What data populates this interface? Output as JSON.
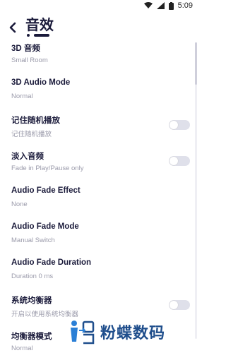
{
  "status_bar": {
    "time": "5:09",
    "icons": [
      "wifi-icon",
      "signal-icon",
      "battery-icon"
    ]
  },
  "header": {
    "title": "音效",
    "back_icon": "chevron-left-icon"
  },
  "settings": {
    "items": [
      {
        "title": "3D 音频",
        "subtitle": "Small Room",
        "toggle": null
      },
      {
        "title": "3D Audio Mode",
        "subtitle": "Normal",
        "toggle": null
      },
      {
        "title": "记住随机播放",
        "subtitle": "记住随机播放",
        "toggle": false
      },
      {
        "title": "淡入音频",
        "subtitle": "Fade in Play/Pause only",
        "toggle": false
      },
      {
        "title": "Audio Fade Effect",
        "subtitle": "None",
        "toggle": null
      },
      {
        "title": "Audio Fade Mode",
        "subtitle": "Manual Switch",
        "toggle": null
      },
      {
        "title": "Audio Fade Duration",
        "subtitle": "Duration 0 ms",
        "toggle": null
      },
      {
        "title": "系统均衡器",
        "subtitle": "开启以使用系统均衡器",
        "toggle": false
      },
      {
        "title": "均衡器模式",
        "subtitle": "Normal",
        "toggle": null
      }
    ]
  },
  "watermark": {
    "text": "粉蝶数码"
  },
  "colors": {
    "title": "#1a1a3a",
    "subtitle": "#9a9aaa",
    "toggle_off": "#dfe0ea",
    "watermark": "#1f4e8c"
  }
}
